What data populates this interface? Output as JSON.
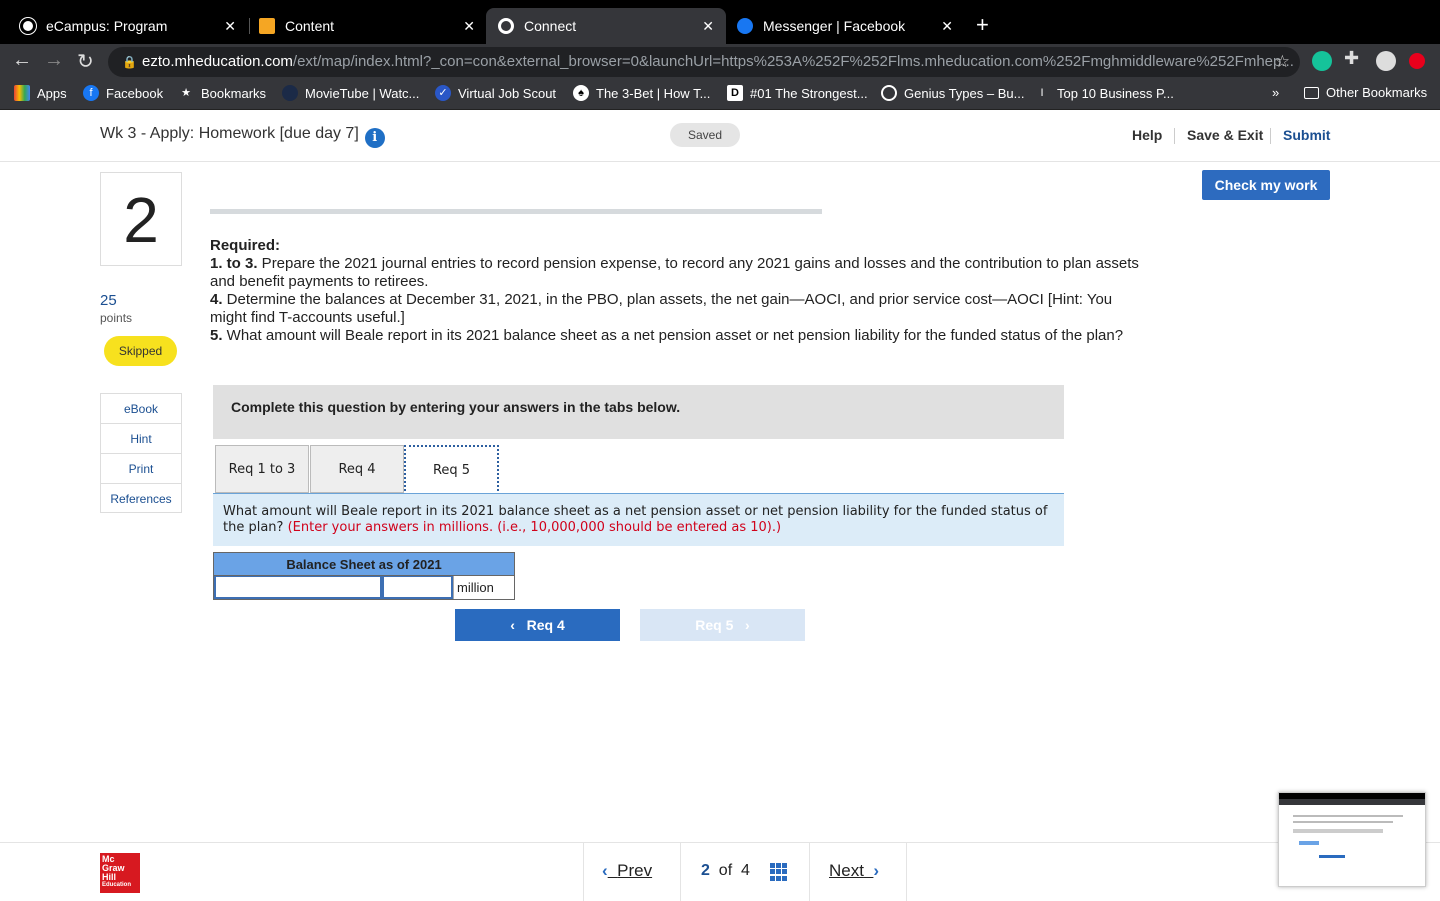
{
  "browser": {
    "tabs": [
      {
        "title": "eCampus: Program",
        "favicon_color": "#ffffff"
      },
      {
        "title": "Content",
        "favicon_color": "#f5a623"
      },
      {
        "title": "Connect",
        "favicon_color": "#ffffff"
      },
      {
        "title": "Messenger | Facebook",
        "favicon_color": "#1877f2"
      }
    ],
    "url_host": "ezto.mheducation.com",
    "url_path": "/ext/map/index.html?_con=con&external_browser=0&launchUrl=https%253A%252F%252Flms.mheducation.com%252Fmghmiddleware%252Fmhep...",
    "bookmarks": [
      {
        "label": "Apps"
      },
      {
        "label": "Facebook"
      },
      {
        "label": "Bookmarks"
      },
      {
        "label": "MovieTube | Watc..."
      },
      {
        "label": "Virtual Job Scout"
      },
      {
        "label": "The 3-Bet | How T..."
      },
      {
        "label": "#01 The Strongest..."
      },
      {
        "label": "Genius Types – Bu..."
      },
      {
        "label": "Top 10 Business P..."
      }
    ],
    "more": "»",
    "other_bookmarks": "Other Bookmarks"
  },
  "header": {
    "title": "Wk 3 - Apply: Homework [due day 7]",
    "saved": "Saved",
    "help": "Help",
    "save_exit": "Save & Exit",
    "submit": "Submit"
  },
  "question": {
    "number": "2",
    "points": "25",
    "points_label": "points",
    "status": "Skipped",
    "links": [
      "eBook",
      "Hint",
      "Print",
      "References"
    ]
  },
  "check_work": "Check my work",
  "required": {
    "heading": "Required:",
    "items": [
      {
        "num": "1. to 3.",
        "text": " Prepare the 2021 journal entries to record pension expense, to record any 2021 gains and losses and the contribution to plan assets and benefit payments to retirees."
      },
      {
        "num": "4.",
        "text": " Determine the balances at December 31, 2021, in the PBO, plan assets, the net gain—AOCI, and prior service cost—AOCI [Hint: You might find T-accounts useful.]"
      },
      {
        "num": "5.",
        "text": " What amount will Beale report in its 2021 balance sheet as a net pension asset or net pension liability for the funded status of the plan?"
      }
    ]
  },
  "instructions": "Complete this question by entering your answers in the tabs below.",
  "tabs": [
    "Req 1 to 3",
    "Req 4",
    "Req 5"
  ],
  "prompt": {
    "text": "What amount will Beale report in its 2021 balance sheet as a net pension asset or net pension liability for the funded status of the plan? ",
    "note": "(Enter your answers in millions. (i.e., 10,000,000 should be entered as 10).)"
  },
  "table": {
    "header": "Balance Sheet as of 2021",
    "input1_value": "",
    "input2_value": "",
    "unit": "million"
  },
  "nav_buttons": {
    "prev": "Req 4",
    "next": "Req 5"
  },
  "footer": {
    "logo_lines": [
      "Mc",
      "Graw",
      "Hill",
      "Education"
    ],
    "prev": "Prev",
    "current": "2",
    "of": "of",
    "total": "4",
    "next": "Next"
  },
  "colors": {
    "accent": "#2a6bbf",
    "skipped": "#f7e11e",
    "note_red": "#d0021b"
  }
}
